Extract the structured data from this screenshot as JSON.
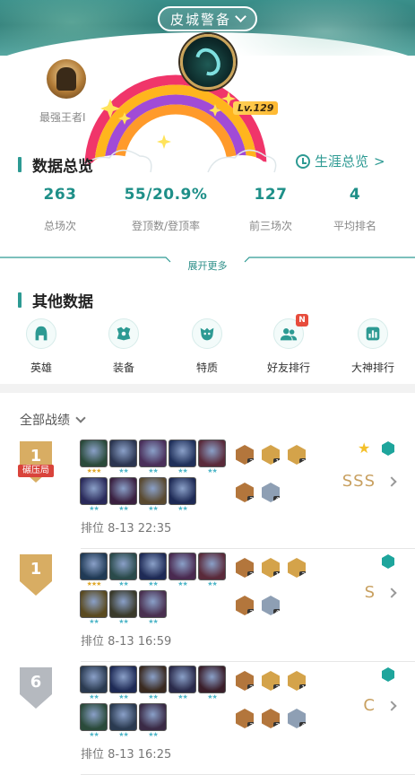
{
  "header": {
    "server_label": "皮城警备",
    "rank_label": "最强王者I",
    "level_tag": "Lv.129"
  },
  "summary": {
    "title": "数据总览",
    "career_link": "生涯总览",
    "career_arrow": ">",
    "stats": [
      {
        "value": "263",
        "label": "总场次"
      },
      {
        "value": "55/20.9%",
        "label": "登顶数/登顶率"
      },
      {
        "value": "127",
        "label": "前三场次"
      },
      {
        "value": "4",
        "label": "平均排名"
      }
    ],
    "expand_label": "展开更多"
  },
  "other": {
    "title": "其他数据",
    "tools": [
      {
        "label": "英雄",
        "icon": "helmet-icon"
      },
      {
        "label": "装备",
        "icon": "equipment-icon"
      },
      {
        "label": "特质",
        "icon": "trait-icon"
      },
      {
        "label": "好友排行",
        "icon": "friends-icon",
        "badge": "N"
      },
      {
        "label": "大神排行",
        "icon": "chart-icon"
      }
    ]
  },
  "matches": {
    "filter_label": "全部战绩",
    "items": [
      {
        "place": "1",
        "place_tier": "gold",
        "tag": "碾压局",
        "grade": "SSS",
        "mode": "排位",
        "time": "8-13 22:35",
        "mvp": true,
        "units_top": [
          {
            "stars": "★★★",
            "color": "#2a4a3a"
          },
          {
            "stars": "★★",
            "color": "#2b3550"
          },
          {
            "stars": "★★",
            "color": "#4a2f5a"
          },
          {
            "stars": "★★",
            "color": "#20305a"
          },
          {
            "stars": "★★",
            "color": "#5a2a3a"
          }
        ],
        "units_bottom": [
          {
            "stars": "★★",
            "color": "#2a2a5a"
          },
          {
            "stars": "★★",
            "color": "#3a2040"
          },
          {
            "stars": "★★",
            "color": "#5a4a30"
          },
          {
            "stars": "★★",
            "color": "#1e2a55"
          }
        ],
        "augments": [
          {
            "lvl": "2",
            "tier": "bronze"
          },
          {
            "lvl": "1",
            "tier": "gold"
          },
          {
            "lvl": "3",
            "tier": "gold"
          },
          {
            "lvl": "3",
            "tier": "bronze"
          },
          {
            "lvl": "4",
            "tier": "silver"
          }
        ]
      },
      {
        "place": "1",
        "place_tier": "gold",
        "tag": "",
        "grade": "S",
        "mode": "排位",
        "time": "8-13 16:59",
        "mvp": false,
        "units_top": [
          {
            "stars": "★★★",
            "color": "#203a55"
          },
          {
            "stars": "★★",
            "color": "#2a4a4a"
          },
          {
            "stars": "★★",
            "color": "#1e2a55"
          },
          {
            "stars": "★★",
            "color": "#4a2a50"
          },
          {
            "stars": "★★",
            "color": "#5a2a3a"
          }
        ],
        "units_bottom": [
          {
            "stars": "★★",
            "color": "#5a4a20"
          },
          {
            "stars": "★★",
            "color": "#3a3a2a"
          },
          {
            "stars": "★★",
            "color": "#4a3050"
          }
        ],
        "augments": [
          {
            "lvl": "2",
            "tier": "bronze"
          },
          {
            "lvl": "1",
            "tier": "gold"
          },
          {
            "lvl": "3",
            "tier": "gold"
          },
          {
            "lvl": "3",
            "tier": "bronze"
          },
          {
            "lvl": "4",
            "tier": "silver"
          }
        ]
      },
      {
        "place": "6",
        "place_tier": "silver",
        "tag": "",
        "grade": "C",
        "mode": "排位",
        "time": "8-13 16:25",
        "mvp": false,
        "units_top": [
          {
            "stars": "★★",
            "color": "#2a3a50"
          },
          {
            "stars": "★★",
            "color": "#1e2a55"
          },
          {
            "stars": "★★",
            "color": "#3a2a20"
          },
          {
            "stars": "★★",
            "color": "#2a2a4a"
          },
          {
            "stars": "★★",
            "color": "#3a1e2a"
          }
        ],
        "units_bottom": [
          {
            "stars": "★★",
            "color": "#2a4a3a"
          },
          {
            "stars": "★★",
            "color": "#2a3a50"
          },
          {
            "stars": "★★",
            "color": "#3a2a45"
          }
        ],
        "augments": [
          {
            "lvl": "2",
            "tier": "bronze"
          },
          {
            "lvl": "3",
            "tier": "gold"
          },
          {
            "lvl": "1",
            "tier": "gold"
          },
          {
            "lvl": "3",
            "tier": "bronze"
          },
          {
            "lvl": "3",
            "tier": "bronze"
          },
          {
            "lvl": "4",
            "tier": "silver"
          }
        ]
      }
    ]
  },
  "colors": {
    "accent": "#2d9a93",
    "grade": "#c8a060",
    "crush_tag": "#d9433b"
  }
}
